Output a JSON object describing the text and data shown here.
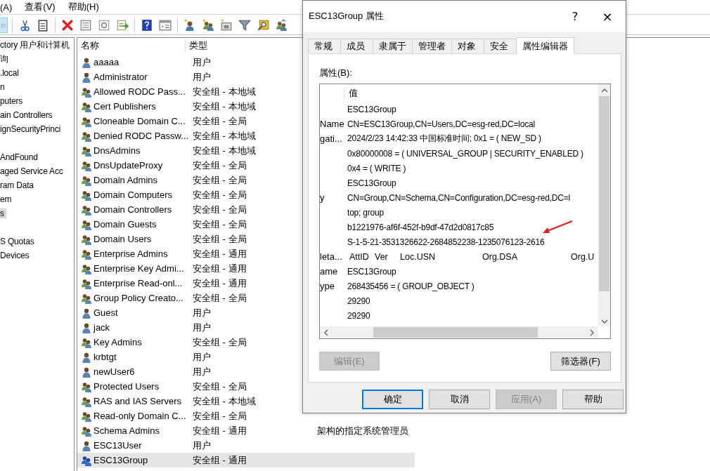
{
  "menu": [
    "(A)",
    "查看(V)",
    "帮助(H)"
  ],
  "toolbar": [
    {
      "kind": "back"
    },
    {
      "kind": "cut"
    },
    {
      "kind": "paste"
    },
    {
      "kind": "delete"
    },
    {
      "kind": "properties"
    },
    {
      "kind": "refresh"
    },
    {
      "kind": "export"
    },
    {
      "kind": "help"
    },
    {
      "kind": "view"
    },
    {
      "kind": "new-user"
    },
    {
      "kind": "new-group"
    },
    {
      "kind": "new-ou"
    },
    {
      "kind": "filter"
    },
    {
      "kind": "find"
    },
    {
      "kind": "add-to-group"
    }
  ],
  "tree": [
    {
      "kind": "label",
      "label": "ctory 用户和计算机",
      "selected": false
    },
    {
      "kind": "label",
      "label": "询",
      "selected": false
    },
    {
      "kind": "label",
      "label": ".local",
      "selected": false
    },
    {
      "kind": "label",
      "label": "n",
      "selected": false
    },
    {
      "kind": "label",
      "label": "puters",
      "selected": false
    },
    {
      "kind": "label",
      "label": "ain Controllers",
      "selected": false
    },
    {
      "kind": "label",
      "label": "ignSecurityPrinci",
      "selected": false
    },
    {
      "kind": "blank"
    },
    {
      "kind": "label",
      "label": "AndFound",
      "selected": false
    },
    {
      "kind": "label",
      "label": "aged Service Acc",
      "selected": false
    },
    {
      "kind": "label",
      "label": "ram Data",
      "selected": false
    },
    {
      "kind": "label",
      "label": "em",
      "selected": false
    },
    {
      "kind": "label",
      "label": "s",
      "selected": true
    },
    {
      "kind": "blank"
    },
    {
      "kind": "label",
      "label": "S Quotas",
      "selected": false
    },
    {
      "kind": "label",
      "label": " Devices",
      "selected": false
    }
  ],
  "list": {
    "columns": [
      "名称",
      "类型"
    ],
    "rows": [
      {
        "kind": "user",
        "name": "aaaaa",
        "type": "用户",
        "selected": false
      },
      {
        "kind": "user",
        "name": "Administrator",
        "type": "用户",
        "selected": false
      },
      {
        "kind": "group",
        "name": "Allowed RODC Pass...",
        "type": "安全组 - 本地域",
        "selected": false
      },
      {
        "kind": "group",
        "name": "Cert Publishers",
        "type": "安全组 - 本地域",
        "selected": false
      },
      {
        "kind": "group",
        "name": "Cloneable Domain C...",
        "type": "安全组 - 全局",
        "selected": false
      },
      {
        "kind": "group",
        "name": "Denied RODC Passw...",
        "type": "安全组 - 本地域",
        "selected": false
      },
      {
        "kind": "group",
        "name": "DnsAdmins",
        "type": "安全组 - 本地域",
        "selected": false
      },
      {
        "kind": "group",
        "name": "DnsUpdateProxy",
        "type": "安全组 - 全局",
        "selected": false
      },
      {
        "kind": "group",
        "name": "Domain Admins",
        "type": "安全组 - 全局",
        "selected": false
      },
      {
        "kind": "group",
        "name": "Domain Computers",
        "type": "安全组 - 全局",
        "selected": false
      },
      {
        "kind": "group",
        "name": "Domain Controllers",
        "type": "安全组 - 全局",
        "selected": false
      },
      {
        "kind": "group",
        "name": "Domain Guests",
        "type": "安全组 - 全局",
        "selected": false
      },
      {
        "kind": "group",
        "name": "Domain Users",
        "type": "安全组 - 全局",
        "selected": false
      },
      {
        "kind": "group",
        "name": "Enterprise Admins",
        "type": "安全组 - 通用",
        "selected": false
      },
      {
        "kind": "group",
        "name": "Enterprise Key Admi...",
        "type": "安全组 - 通用",
        "selected": false
      },
      {
        "kind": "group",
        "name": "Enterprise Read-onl...",
        "type": "安全组 - 通用",
        "selected": false
      },
      {
        "kind": "group",
        "name": "Group Policy Creato...",
        "type": "安全组 - 全局",
        "selected": false
      },
      {
        "kind": "user",
        "name": "Guest",
        "type": "用户",
        "selected": false
      },
      {
        "kind": "user",
        "name": "jack",
        "type": "用户",
        "selected": false
      },
      {
        "kind": "group",
        "name": "Key Admins",
        "type": "安全组 - 全局",
        "selected": false
      },
      {
        "kind": "user",
        "name": "krbtgt",
        "type": "用户",
        "selected": false
      },
      {
        "kind": "user",
        "name": "newUser6",
        "type": "用户",
        "selected": false
      },
      {
        "kind": "group",
        "name": "Protected Users",
        "type": "安全组 - 全局",
        "selected": false
      },
      {
        "kind": "group",
        "name": "RAS and IAS Servers",
        "type": "安全组 - 本地域",
        "selected": false
      },
      {
        "kind": "group",
        "name": "Read-only Domain C...",
        "type": "安全组 - 全局",
        "selected": false
      },
      {
        "kind": "group",
        "name": "Schema Admins",
        "type": "安全组 - 通用",
        "description": "架构的指定系统管理员",
        "selected": false
      },
      {
        "kind": "user",
        "name": "ESC13User",
        "type": "用户",
        "selected": false
      },
      {
        "kind": "group",
        "name": "ESC13Group",
        "type": "安全组 - 通用",
        "selected": true
      }
    ]
  },
  "dialog": {
    "title": "ESC13Group 属性",
    "help": "?",
    "close": "×",
    "tabs": [
      {
        "label": "常规",
        "selected": false
      },
      {
        "label": "成员",
        "selected": false
      },
      {
        "label": "隶属于",
        "selected": false
      },
      {
        "label": "管理者",
        "selected": false
      },
      {
        "label": "对象",
        "selected": false
      },
      {
        "label": "安全",
        "selected": false
      },
      {
        "label": "属性编辑器",
        "selected": true
      }
    ],
    "attributes_label": "属性(B):",
    "value_header": "值",
    "attributes": [
      {
        "kind": "text",
        "value": "ESC13Group"
      },
      {
        "kind": "text",
        "name": "Name",
        "value": "CN=ESC13Group,CN=Users,DC=esg-red,DC=local"
      },
      {
        "kind": "text",
        "name": "gati...",
        "value": "2024/2/23 14:42:33 中国标准时间; 0x1 = ( NEW_SD )"
      },
      {
        "kind": "text",
        "value": "0x80000008 = ( UNIVERSAL_GROUP | SECURITY_ENABLED )"
      },
      {
        "kind": "text",
        "value": "0x4 = ( WRITE )"
      },
      {
        "kind": "text",
        "value": "ESC13Group"
      },
      {
        "kind": "text",
        "name": "y",
        "value": "CN=Group,CN=Schema,CN=Configuration,DC=esg-red,DC=l"
      },
      {
        "kind": "text",
        "value": "top; group"
      },
      {
        "kind": "text",
        "value": "b1221976-af6f-452f-b9df-47d2d0817c85"
      },
      {
        "kind": "text",
        "value": "S-1-5-21-3531326622-2684852238-1235076123-2616"
      },
      {
        "kind": "columns",
        "name": "leta...",
        "cells": [
          "AttID",
          "Ver",
          "Loc.USN",
          "Org.DSA",
          "Org.U"
        ]
      },
      {
        "kind": "text",
        "name": "ame",
        "value": "ESC13Group"
      },
      {
        "kind": "text",
        "name": "ype",
        "value": "268435456 = ( GROUP_OBJECT )"
      },
      {
        "kind": "text",
        "value": "29290"
      },
      {
        "kind": "text",
        "value": "29290"
      }
    ],
    "edit_button": {
      "label": "编辑(E)",
      "disabled": true
    },
    "filter_button": {
      "label": "筛选器(F)",
      "disabled": false
    },
    "buttons": [
      {
        "label": "确定",
        "default": true,
        "disabled": false
      },
      {
        "label": "取消",
        "default": false,
        "disabled": false
      },
      {
        "label": "应用(A)",
        "default": false,
        "disabled": true
      },
      {
        "label": "帮助",
        "default": false,
        "disabled": false
      }
    ]
  }
}
